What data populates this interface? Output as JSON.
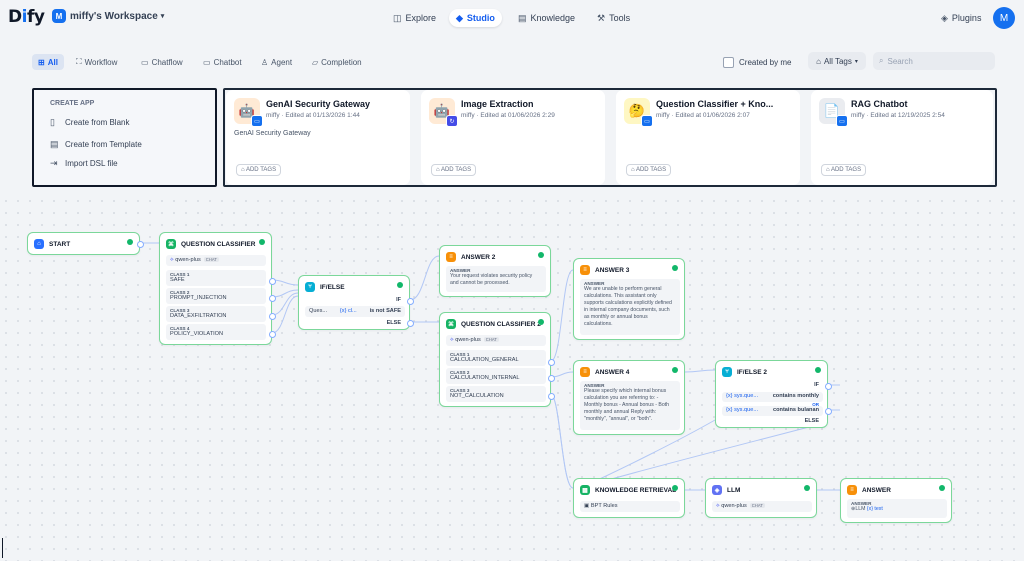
{
  "header": {
    "logo": "Dify",
    "workspace_badge": "M",
    "workspace_name": "miffy's Workspace",
    "nav": [
      {
        "label": "Explore",
        "icon": "explore-icon"
      },
      {
        "label": "Studio",
        "icon": "studio-icon",
        "active": true
      },
      {
        "label": "Knowledge",
        "icon": "knowledge-icon"
      },
      {
        "label": "Tools",
        "icon": "tools-icon"
      }
    ],
    "plugins_label": "Plugins",
    "avatar": "M"
  },
  "filters": {
    "tabs": [
      "All",
      "Workflow",
      "Chatflow",
      "Chatbot",
      "Agent",
      "Completion"
    ],
    "created_by_me": "Created by me",
    "tags": "All Tags",
    "search_placeholder": "Search"
  },
  "create_app": {
    "title": "CREATE APP",
    "items": [
      "Create from Blank",
      "Create from Template",
      "Import DSL file"
    ]
  },
  "apps": [
    {
      "name": "GenAI Security Gateway",
      "meta": "miffy · Edited at 01/13/2026 1:44",
      "desc": "GenAI Security Gateway",
      "add_tags": "ADD TAGS",
      "icon": "robot-icon"
    },
    {
      "name": "Image Extraction",
      "meta": "miffy · Edited at 01/06/2026 2:29",
      "desc": "",
      "add_tags": "ADD TAGS",
      "icon": "robot-icon"
    },
    {
      "name": "Question Classifier + Kno...",
      "meta": "miffy · Edited at 01/06/2026 2:07",
      "desc": "",
      "add_tags": "ADD TAGS",
      "icon": "thinking-face-icon"
    },
    {
      "name": "RAG Chatbot",
      "meta": "miffy · Edited at 12/19/2025 2:54",
      "desc": "",
      "add_tags": "ADD TAGS",
      "icon": "document-icon"
    }
  ],
  "workflow": {
    "start": {
      "title": "START"
    },
    "qc1": {
      "title": "QUESTION CLASSIFIER",
      "model": "qwen-plus",
      "model_tag": "CHAT",
      "classes": [
        {
          "label": "CLASS 1",
          "value": "SAFE"
        },
        {
          "label": "CLASS 2",
          "value": "PROMPT_INJECTION"
        },
        {
          "label": "CLASS 3",
          "value": "DATA_EXFILTRATION"
        },
        {
          "label": "CLASS 4",
          "value": "POLICY_VIOLATION"
        }
      ]
    },
    "ifelse1": {
      "title": "IF/ELSE",
      "if": "IF",
      "cond_var": "Ques...",
      "cond_ref": "{x} cl...",
      "cond_op": "is not SAFE",
      "else": "ELSE"
    },
    "answer2": {
      "title": "ANSWER 2",
      "label": "ANSWER",
      "text": "Your request violates security policy and cannot be processed."
    },
    "qc2": {
      "title": "QUESTION CLASSIFIER 2",
      "model": "qwen-plus",
      "model_tag": "CHAT",
      "classes": [
        {
          "label": "CLASS 1",
          "value": "CALCULATION_GENERAL"
        },
        {
          "label": "CLASS 2",
          "value": "CALCULATION_INTERNAL"
        },
        {
          "label": "CLASS 3",
          "value": "NOT_CALCULATION"
        }
      ]
    },
    "answer3": {
      "title": "ANSWER 3",
      "label": "ANSWER",
      "text": "We are unable to perform general calculations. This assistant only supports calculations explicitly defined in internal company documents, such as monthly or annual bonus calculations."
    },
    "answer4": {
      "title": "ANSWER 4",
      "label": "ANSWER",
      "text": "Please specify which internal bonus calculation you are referring to: - Monthly bonus - Annual bonus - Both monthly and annual Reply with: \"monthly\", \"annual\", or \"both\"."
    },
    "ifelse2": {
      "title": "IF/ELSE 2",
      "if": "IF",
      "c1_var": "{x} sys.que...",
      "c1_op": "contains monthly",
      "or": "OR",
      "c2_var": "{x} sys.que...",
      "c2_op": "contains bulanan",
      "else": "ELSE"
    },
    "kr": {
      "title": "KNOWLEDGE RETRIEVAL",
      "dataset": "BPT Rules"
    },
    "llm": {
      "title": "LLM",
      "model": "qwen-plus",
      "model_tag": "CHAT"
    },
    "answer": {
      "title": "ANSWER",
      "label": "ANSWER",
      "ref": "LLM",
      "ref_var": "{x} text"
    }
  },
  "colors": {
    "accent": "#155eef",
    "node_border": "#7bd79a",
    "success": "#12b76a",
    "answer": "#f79009",
    "classifier": "#16b364",
    "ifelse": "#06aed4",
    "llm": "#6172f3"
  }
}
